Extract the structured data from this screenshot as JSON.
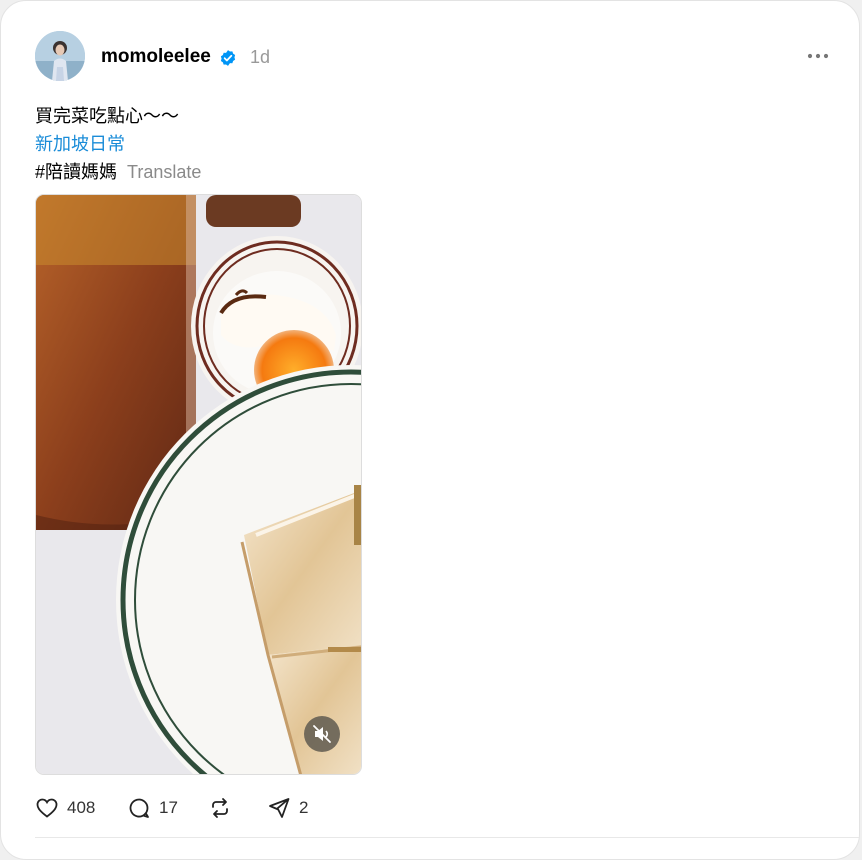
{
  "post": {
    "username": "momoleelee",
    "time": "1d",
    "caption": {
      "text": "買完菜吃點心～～",
      "link": "新加坡日常",
      "hashtag": "#陪讀媽媽",
      "translate": "Translate"
    },
    "media": {
      "muted": true
    },
    "actions": {
      "likes": "408",
      "comments": "17",
      "reposts": "",
      "shares": "2"
    }
  },
  "colors": {
    "link": "#1a8cd8",
    "verified": "#0095f6",
    "muted_text": "#999999"
  },
  "icons": [
    "verified-badge-icon",
    "more-icon",
    "mute-icon",
    "heart-icon",
    "comment-icon",
    "repost-icon",
    "share-icon"
  ]
}
